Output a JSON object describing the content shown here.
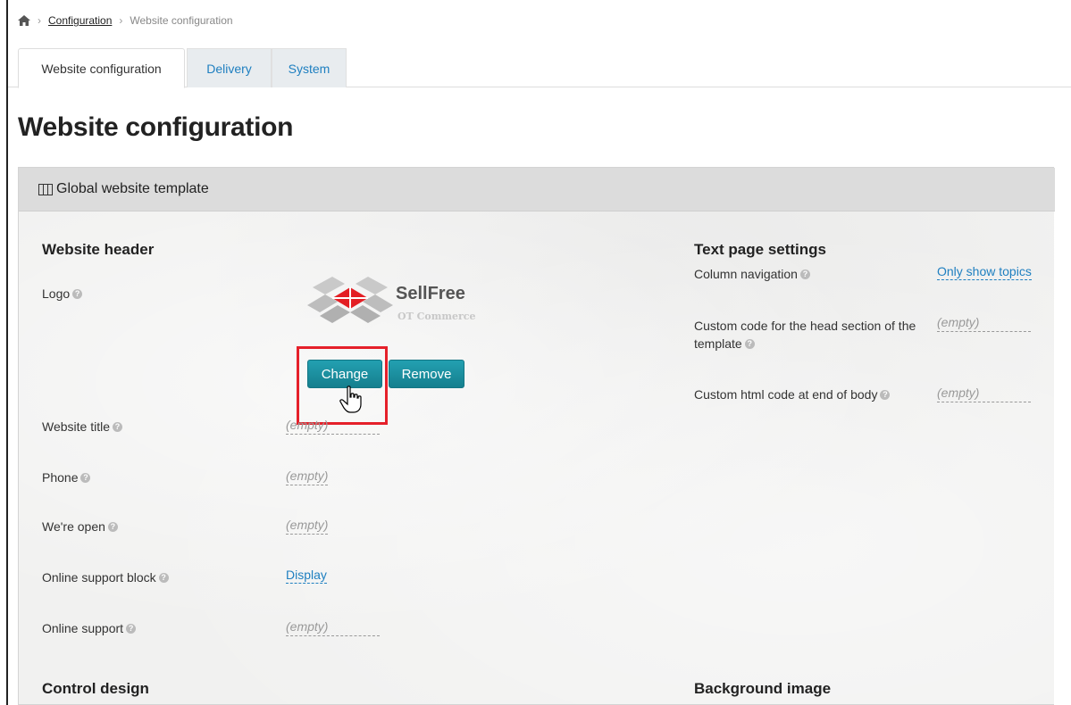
{
  "breadcrumb": {
    "home_icon": "home-icon",
    "items": [
      "Configuration",
      "Website configuration"
    ]
  },
  "tabs": [
    {
      "label": "Website configuration",
      "active": true
    },
    {
      "label": "Delivery",
      "active": false
    },
    {
      "label": "System",
      "active": false
    }
  ],
  "page_title": "Website configuration",
  "panel": {
    "title": "Global website template",
    "icon": "layout-columns-icon"
  },
  "website_header": {
    "title": "Website header",
    "logo_label": "Logo",
    "logo_name": "SellFree",
    "logo_sub": "OT Commerce",
    "change_button": "Change",
    "remove_button": "Remove",
    "fields": [
      {
        "label": "Website title",
        "value": "(empty)"
      },
      {
        "label": "Phone",
        "value": "(empty)"
      },
      {
        "label": "We're open",
        "value": "(empty)"
      },
      {
        "label": "Online support block",
        "value": "Display"
      },
      {
        "label": "Online support",
        "value": "(empty)"
      }
    ]
  },
  "text_page_settings": {
    "title": "Text page settings",
    "fields": [
      {
        "label": "Column navigation",
        "value": "Only show topics"
      },
      {
        "label": "Custom code for the head section of the template",
        "value": "(empty)"
      },
      {
        "label": "Custom html code at end of body",
        "value": "(empty)"
      }
    ]
  },
  "control_design": {
    "title": "Control design"
  },
  "background_image": {
    "title": "Background image"
  },
  "colors": {
    "accent": "#1a8fa0",
    "link": "#1e7fc0",
    "highlight": "#e5202a",
    "logo_red": "#e31e24"
  }
}
